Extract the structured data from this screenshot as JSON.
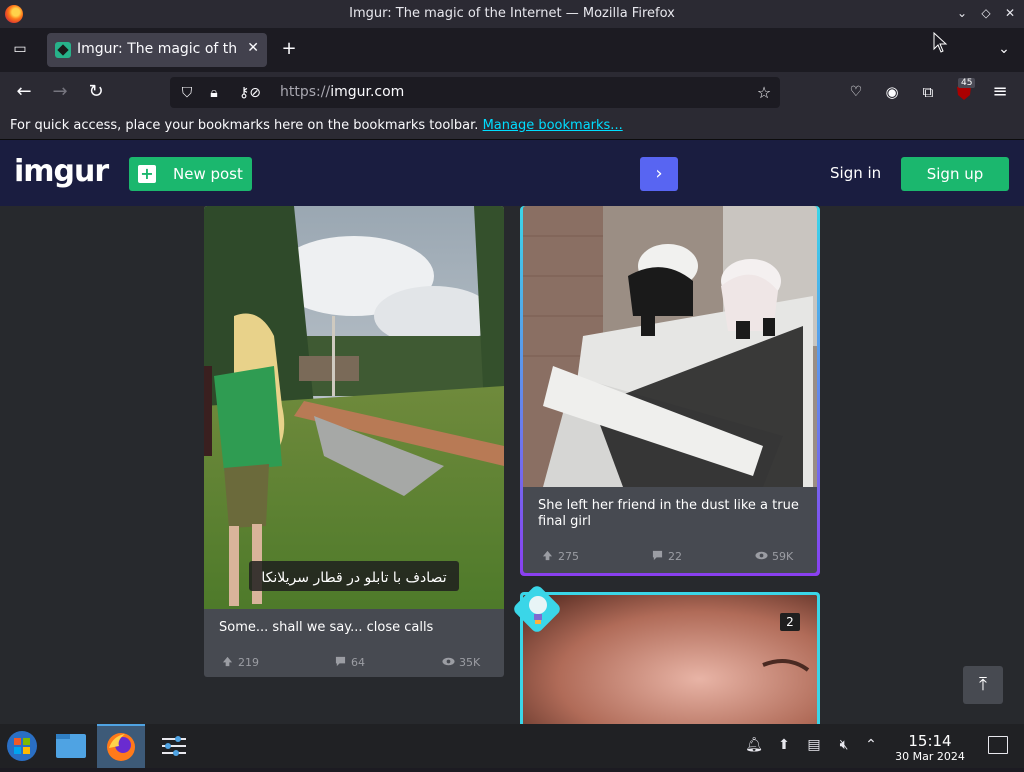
{
  "window": {
    "title": "Imgur: The magic of the Internet — Mozilla Firefox"
  },
  "tabs": [
    {
      "label": "Imgur: The magic of the Internet"
    }
  ],
  "navbar": {
    "url_protocol": "https://",
    "url_host": "imgur.com",
    "extensions_badge": "45"
  },
  "bookmarks": {
    "message": "For quick access, place your bookmarks here on the bookmarks toolbar.",
    "link": "Manage bookmarks..."
  },
  "imgur": {
    "logo": "imgur",
    "new_post": "New post",
    "sign_in": "Sign in",
    "sign_up": "Sign up",
    "posts": [
      {
        "caption": "Some... shall we say... close calls",
        "overlay_text": "تصادف با تابلو در قطار سریلانکا",
        "upvotes": "219",
        "comments": "64",
        "views": "35K"
      },
      {
        "caption": "She left her friend in the dust like a true final girl",
        "upvotes": "275",
        "comments": "22",
        "views": "59K"
      },
      {
        "count_badge": "2"
      }
    ]
  },
  "taskbar": {
    "time": "15:14",
    "date": "30 Mar 2024"
  },
  "colors": {
    "imgur_header": "#1a1d40",
    "imgur_green": "#1bb76e",
    "promo_blue": "#5865f2",
    "card_border_gradient_start": "#3ad6e8",
    "card_border_gradient_end": "#8a3ff0"
  }
}
